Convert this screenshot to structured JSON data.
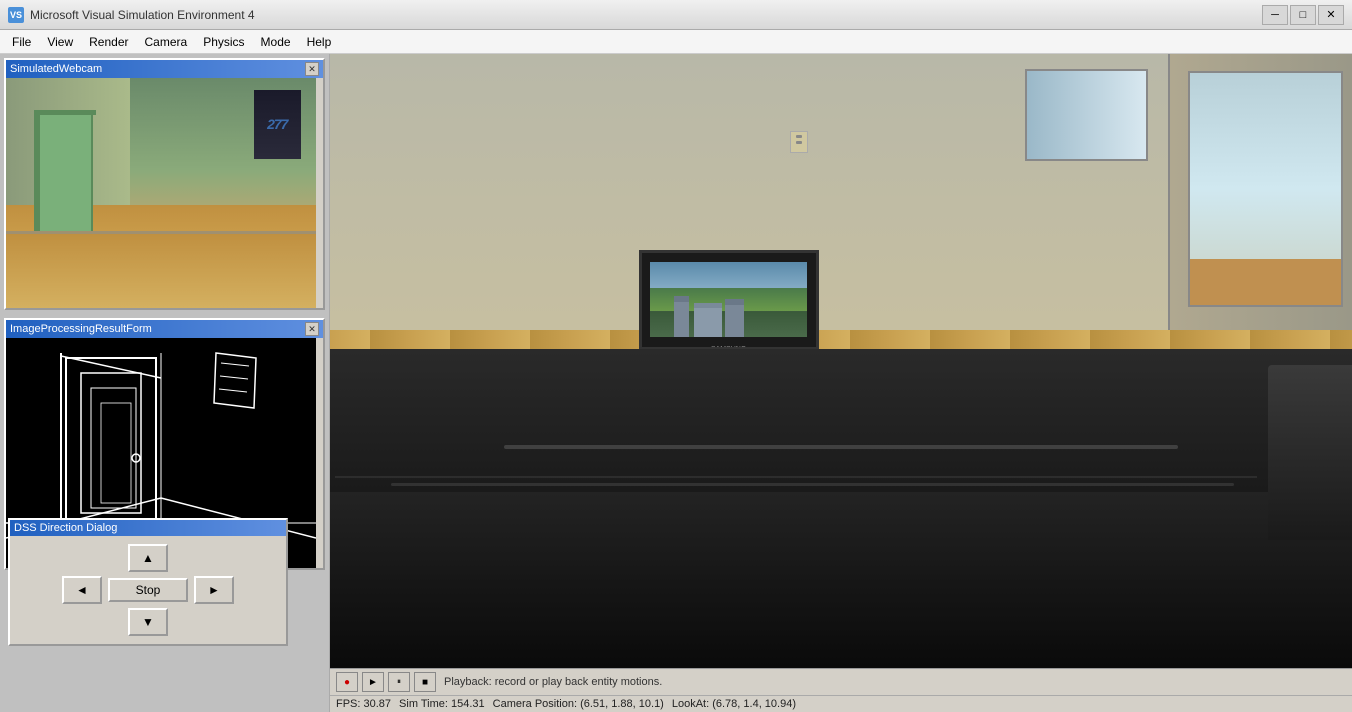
{
  "window": {
    "title": "Microsoft Visual Simulation Environment 4",
    "icon_label": "VS",
    "minimize_label": "─",
    "restore_label": "□",
    "close_label": "✕"
  },
  "menu": {
    "items": [
      {
        "label": "File",
        "id": "file"
      },
      {
        "label": "View",
        "id": "view"
      },
      {
        "label": "Render",
        "id": "render"
      },
      {
        "label": "Camera",
        "id": "camera"
      },
      {
        "label": "Physics",
        "id": "physics"
      },
      {
        "label": "Mode",
        "id": "mode"
      },
      {
        "label": "Help",
        "id": "help"
      }
    ]
  },
  "webcam_panel": {
    "title": "SimulatedWebcam",
    "close_label": "✕"
  },
  "imgproc_panel": {
    "title": "ImageProcessingResultForm",
    "close_label": "✕"
  },
  "dss_dialog": {
    "title": "DSS Direction Dialog",
    "up_label": "▲",
    "left_label": "◄",
    "stop_label": "Stop",
    "right_label": "►",
    "down_label": "▼"
  },
  "playback": {
    "record_label": "●",
    "play_label": "►",
    "pause_label": "⏸",
    "stop_label": "■",
    "status_text": "Playback: record or play back entity motions."
  },
  "status_bar": {
    "fps_label": "FPS: 30.87",
    "sim_time_label": "Sim Time: 154.31",
    "camera_pos_label": "Camera Position: (6.51, 1.88, 10.1)",
    "lookat_label": "LookAt: (6.78, 1.4, 10.94)"
  }
}
